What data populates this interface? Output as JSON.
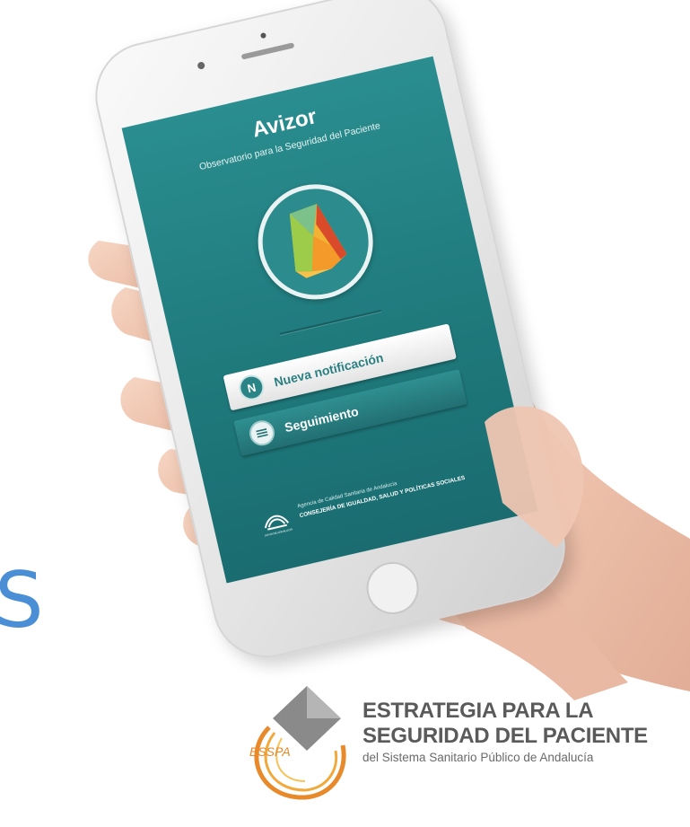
{
  "blue_fragment": "S",
  "phone": {
    "app_title": "Avizor",
    "app_subtitle": "Observatorio para la Seguridad del Paciente",
    "buttons": {
      "new_notification": {
        "label": "Nueva notificación",
        "icon_letter": "N",
        "icon": "n-letter-icon"
      },
      "follow_up": {
        "label": "Seguimiento",
        "icon": "list-circle-icon"
      }
    },
    "footer": {
      "line1": "Agencia de Calidad Sanitaria de Andalucía",
      "line2": "CONSEJERÍA DE IGUALDAD, SALUD Y POLÍTICAS SOCIALES",
      "emblem_caption": "JUNTA DE ANDALUCÍA"
    }
  },
  "esspa": {
    "mark_text": "ESSPA",
    "line1": "ESTRATEGIA PARA LA",
    "line2": "SEGURIDAD DEL PACIENTE",
    "line3": "del Sistema Sanitario Público de Andalucía"
  },
  "colors": {
    "screen_teal": "#1f7a7c",
    "accent_blue": "#4a8fd6",
    "esspa_orange": "#e8892a",
    "text_gray": "#5a5a5a"
  }
}
